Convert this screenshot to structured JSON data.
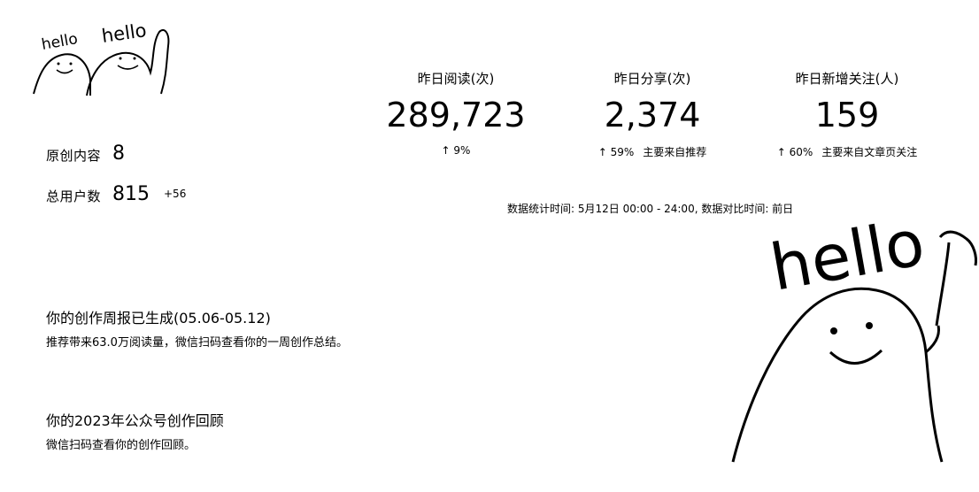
{
  "stickers": {
    "small": {
      "text_left": "hello",
      "text_right": "hello"
    },
    "large": {
      "text": "hello"
    }
  },
  "overview": {
    "original_content": {
      "label": "原创内容",
      "value": "8"
    },
    "total_users": {
      "label": "总用户数",
      "value": "815",
      "delta": "+56"
    }
  },
  "stats": [
    {
      "label": "昨日阅读(次)",
      "value": "289,723",
      "change": "↑ 9%",
      "note": ""
    },
    {
      "label": "昨日分享(次)",
      "value": "2,374",
      "change": "↑ 59%",
      "note": "主要来自推荐"
    },
    {
      "label": "昨日新增关注(人)",
      "value": "159",
      "change": "↑ 60%",
      "note": "主要来自文章页关注"
    }
  ],
  "footnote": "数据统计时间: 5月12日 00:00 - 24:00, 数据对比时间: 前日",
  "reports": [
    {
      "title": "你的创作周报已生成(05.06-05.12)",
      "desc": "推荐带来63.0万阅读量，微信扫码查看你的一周创作总结。"
    },
    {
      "title": "你的2023年公众号创作回顾",
      "desc": "微信扫码查看你的创作回顾。"
    }
  ]
}
